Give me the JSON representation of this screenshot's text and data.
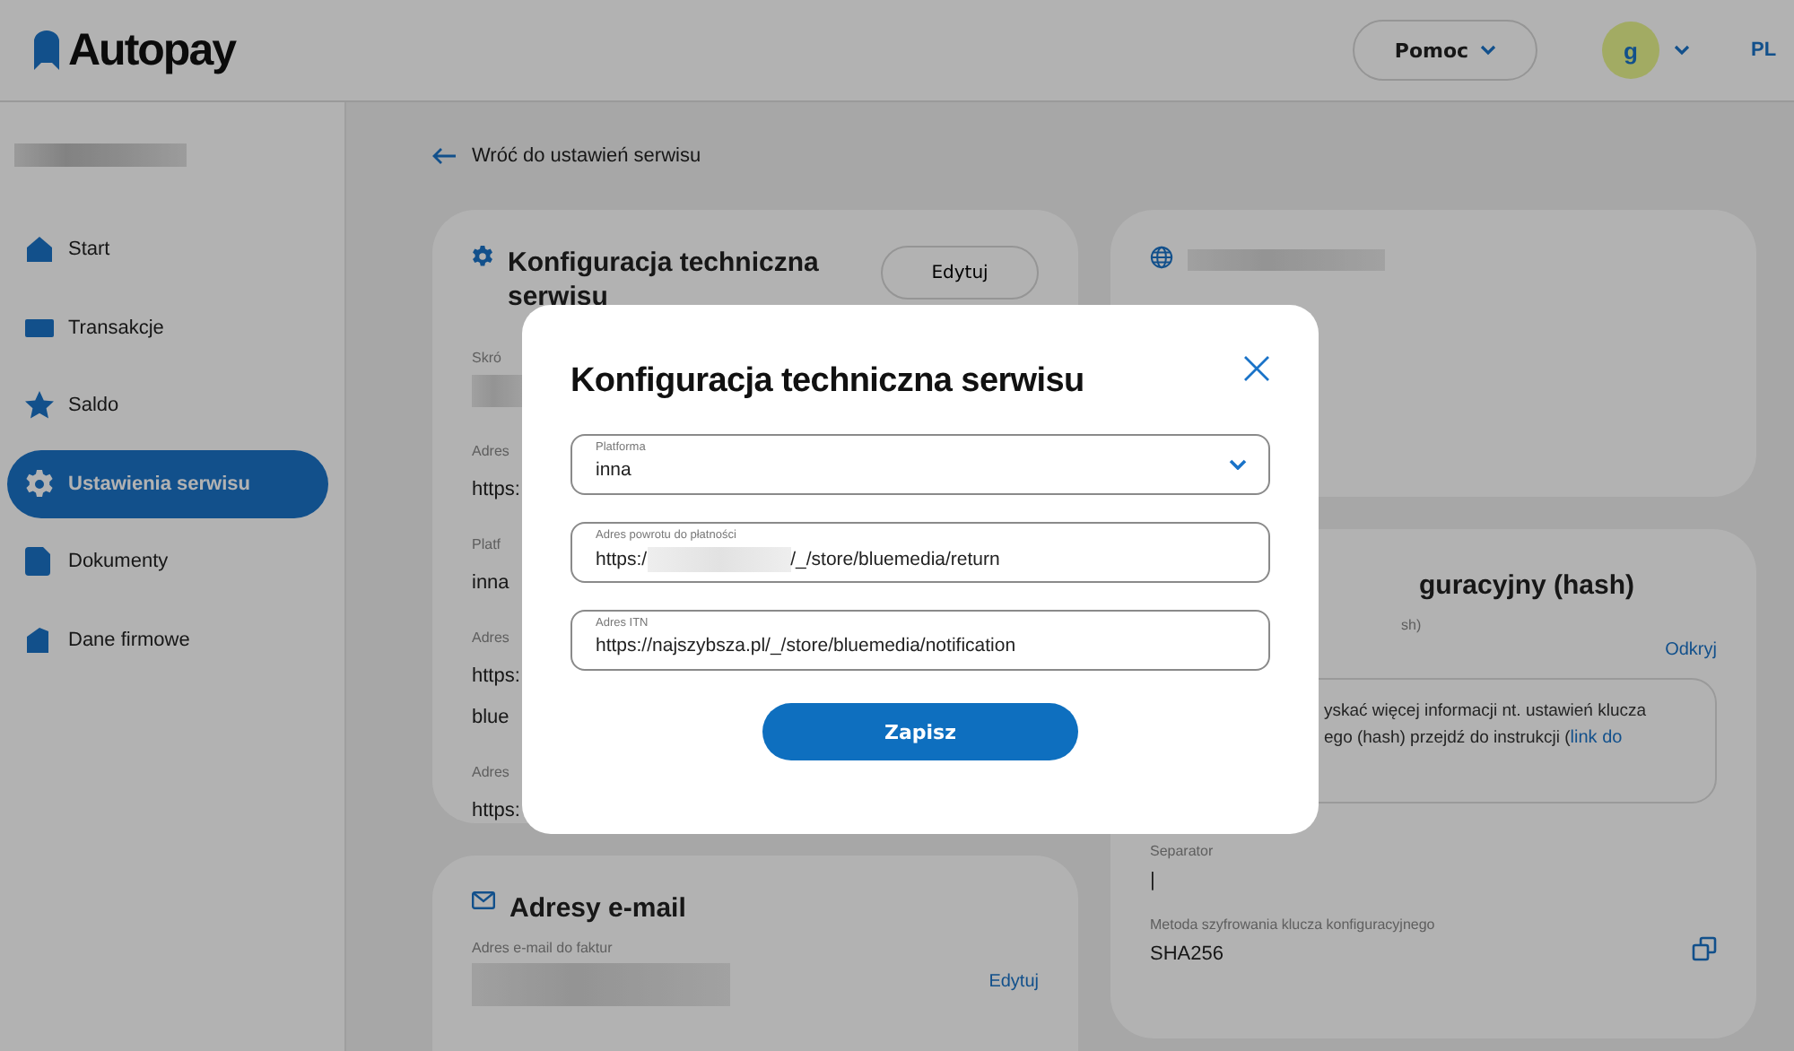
{
  "header": {
    "logo": "Autopay",
    "help_button": "Pomoc",
    "avatar": "g",
    "language": "PL"
  },
  "sidebar": {
    "items": [
      {
        "label": "Start",
        "selected": false
      },
      {
        "label": "Transakcje",
        "selected": false
      },
      {
        "label": "Saldo",
        "selected": false
      },
      {
        "label": "Ustawienia serwisu",
        "selected": true
      },
      {
        "label": "Dokumenty",
        "selected": false
      },
      {
        "label": "Dane firmowe",
        "selected": false
      }
    ]
  },
  "back_link": "Wróć do ustawień serwisu",
  "tech_card": {
    "title": "Konfiguracja techniczna serwisu",
    "edit_button": "Edytuj",
    "fields": [
      {
        "label": "Skró"
      },
      {
        "label": "Adres",
        "value": "https:"
      },
      {
        "label": "Platf",
        "value": "inna"
      },
      {
        "label": "Adres",
        "value": "https:",
        "value_2": "blue"
      },
      {
        "label": "Adres",
        "value": "https:"
      }
    ]
  },
  "email_card": {
    "title": "Adresy e-mail",
    "field_label": "Adres e-mail do faktur",
    "edit_link": "Edytuj"
  },
  "hash_card": {
    "title": "guracyjny (hash)",
    "key_label": "sh)",
    "reveal_link": "Odkryj",
    "info_line_1": "yskać więcej informacji nt. ustawień klucza",
    "info_line_2": "ego (hash) przejdź do instrukcji (",
    "info_link": "link do",
    "separator_label": "Separator",
    "separator_value": "|",
    "method_label": "Metoda szyfrowania klucza konfiguracyjnego",
    "method_value": "SHA256"
  },
  "modal": {
    "title": "Konfiguracja techniczna serwisu",
    "fields": [
      {
        "kind": "select",
        "label": "Platforma",
        "value": "inna"
      },
      {
        "kind": "text",
        "label": "Adres powrotu do płatności",
        "value": "https:/",
        "value_after": "/_/store/bluemedia/return"
      },
      {
        "kind": "text",
        "label": "Adres ITN",
        "value": "https://najszybsza.pl/_/store/bluemedia/notification"
      }
    ],
    "save_button": "Zapisz"
  }
}
